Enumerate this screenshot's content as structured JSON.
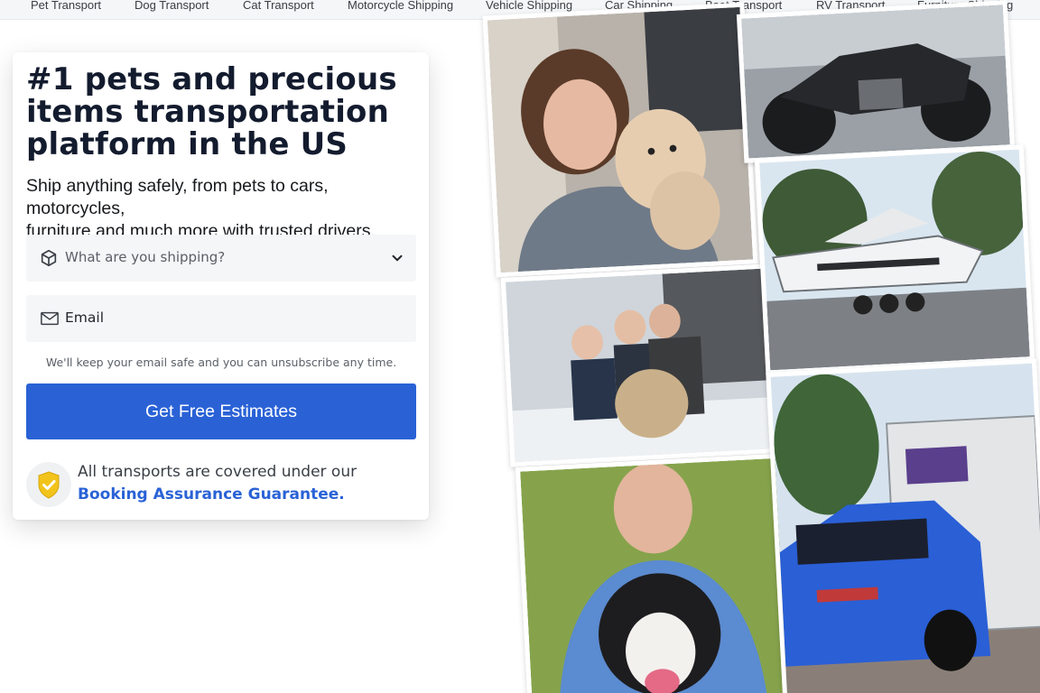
{
  "nav": {
    "items": [
      "Pet Transport",
      "Dog Transport",
      "Cat Transport",
      "Motorcycle Shipping",
      "Vehicle Shipping",
      "Car Shipping",
      "Boat Transport",
      "RV Transport",
      "Furniture Shipping"
    ]
  },
  "hero": {
    "title_line1": "#1 pets and precious",
    "title_line2": "items transportation",
    "title_line3": "platform in the US",
    "subtitle_line1": "Ship anything safely, from pets to cars, motorcycles,",
    "subtitle_line2": "furniture and much more with trusted drivers."
  },
  "form": {
    "shipping_placeholder": "What are you shipping?",
    "email_placeholder": "Email",
    "privacy_note": "We'll keep your email safe and you can unsubscribe any time.",
    "cta_label": "Get Free Estimates"
  },
  "assurance": {
    "line1": "All transports are covered under our",
    "link": "Booking Assurance Guarantee."
  },
  "icons": {
    "shipping": "package-icon",
    "email": "mail-icon",
    "dropdown": "chevron-down-icon",
    "assurance": "shield-check-icon"
  },
  "colors": {
    "accent": "#2a62d6",
    "heading": "#131b2e",
    "field_bg": "#f4f6f8",
    "shield": "#f2c31b"
  }
}
